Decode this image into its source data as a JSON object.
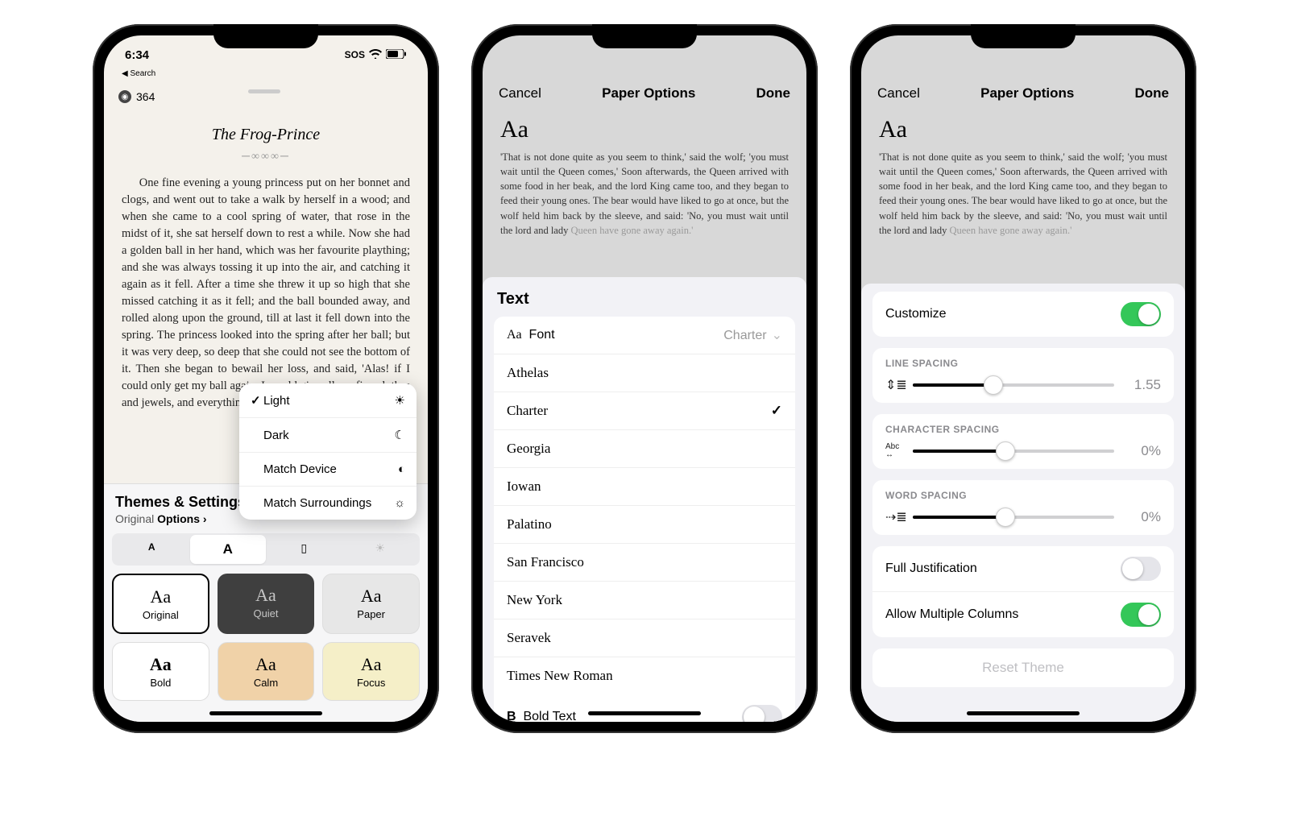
{
  "phone1": {
    "status": {
      "time": "6:34",
      "back_label": "◀ Search",
      "sos": "SOS"
    },
    "page_number": "364",
    "chapter_title": "The Frog-Prince",
    "body_text": "One fine evening a young princess put on her bonnet and clogs, and went out to take a walk by herself in a wood; and when she came to a cool spring of water, that rose in the midst of it, she sat herself down to rest a while. Now she had a golden ball in her hand, which was her favourite plaything; and she was always tossing it up into the air, and catching it again as it fell. After a time she threw it up so high that she missed catching it as it fell; and the ball bounded away, and rolled along upon the ground, till at last it fell down into the spring. The princess looked into the spring after her ball; but it was very deep, so deep that she could not see the bottom of it. Then she began to bewail her loss, and said, 'Alas! if I could only get my ball again, I would give all my fine clothes and jewels, and everything that I have in the world.'",
    "themes_header": "Themes & Settings",
    "themes_sub_original": "Original",
    "themes_sub_options": "Options",
    "seg_smallA": "A",
    "seg_bigA": "A",
    "themes": {
      "original": "Original",
      "quiet": "Quiet",
      "paper": "Paper",
      "bold": "Bold",
      "calm": "Calm",
      "focus": "Focus",
      "Aa": "Aa"
    },
    "popover": {
      "light": "Light",
      "dark": "Dark",
      "match_device": "Match Device",
      "match_surroundings": "Match Surroundings"
    }
  },
  "phone2": {
    "cancel": "Cancel",
    "title": "Paper Options",
    "done": "Done",
    "preview_aa": "Aa",
    "preview_text": "'That is not done quite as you seem to think,' said the wolf; 'you must wait until the Queen comes,' Soon afterwards, the Queen arrived with some food in her beak, and the lord King came too, and they began to feed their young ones. The bear would have liked to go at once, but the wolf held him back by the sleeve, and said: 'No, you must wait until the lord and lady ",
    "preview_fade": "Queen have gone away again.'",
    "section_text": "Text",
    "font_row_label": "Font",
    "font_row_value": "Charter",
    "fonts": [
      "Athelas",
      "Charter",
      "Georgia",
      "Iowan",
      "Palatino",
      "San Francisco",
      "New York",
      "Seravek",
      "Times New Roman"
    ],
    "selected_font": "Charter",
    "bold_text_label": "Bold Text"
  },
  "phone3": {
    "cancel": "Cancel",
    "title": "Paper Options",
    "done": "Done",
    "preview_aa": "Aa",
    "preview_text": "'That is not done quite as you seem to think,' said the wolf; 'you must wait until the Queen comes,' Soon afterwards, the Queen arrived with some food in her beak, and the lord King came too, and they began to feed their young ones. The bear would have liked to go at once, but the wolf held him back by the sleeve, and said: 'No, you must wait until the lord and lady ",
    "preview_fade": "Queen have gone away again.'",
    "customize_label": "Customize",
    "line_spacing": {
      "heading": "LINE SPACING",
      "value": "1.55",
      "pct": 40
    },
    "char_spacing": {
      "heading": "CHARACTER SPACING",
      "value": "0%",
      "icon_text": "Abc",
      "pct": 46
    },
    "word_spacing": {
      "heading": "WORD SPACING",
      "value": "0%",
      "pct": 46
    },
    "full_justification": "Full Justification",
    "allow_columns": "Allow Multiple Columns",
    "reset": "Reset Theme"
  }
}
